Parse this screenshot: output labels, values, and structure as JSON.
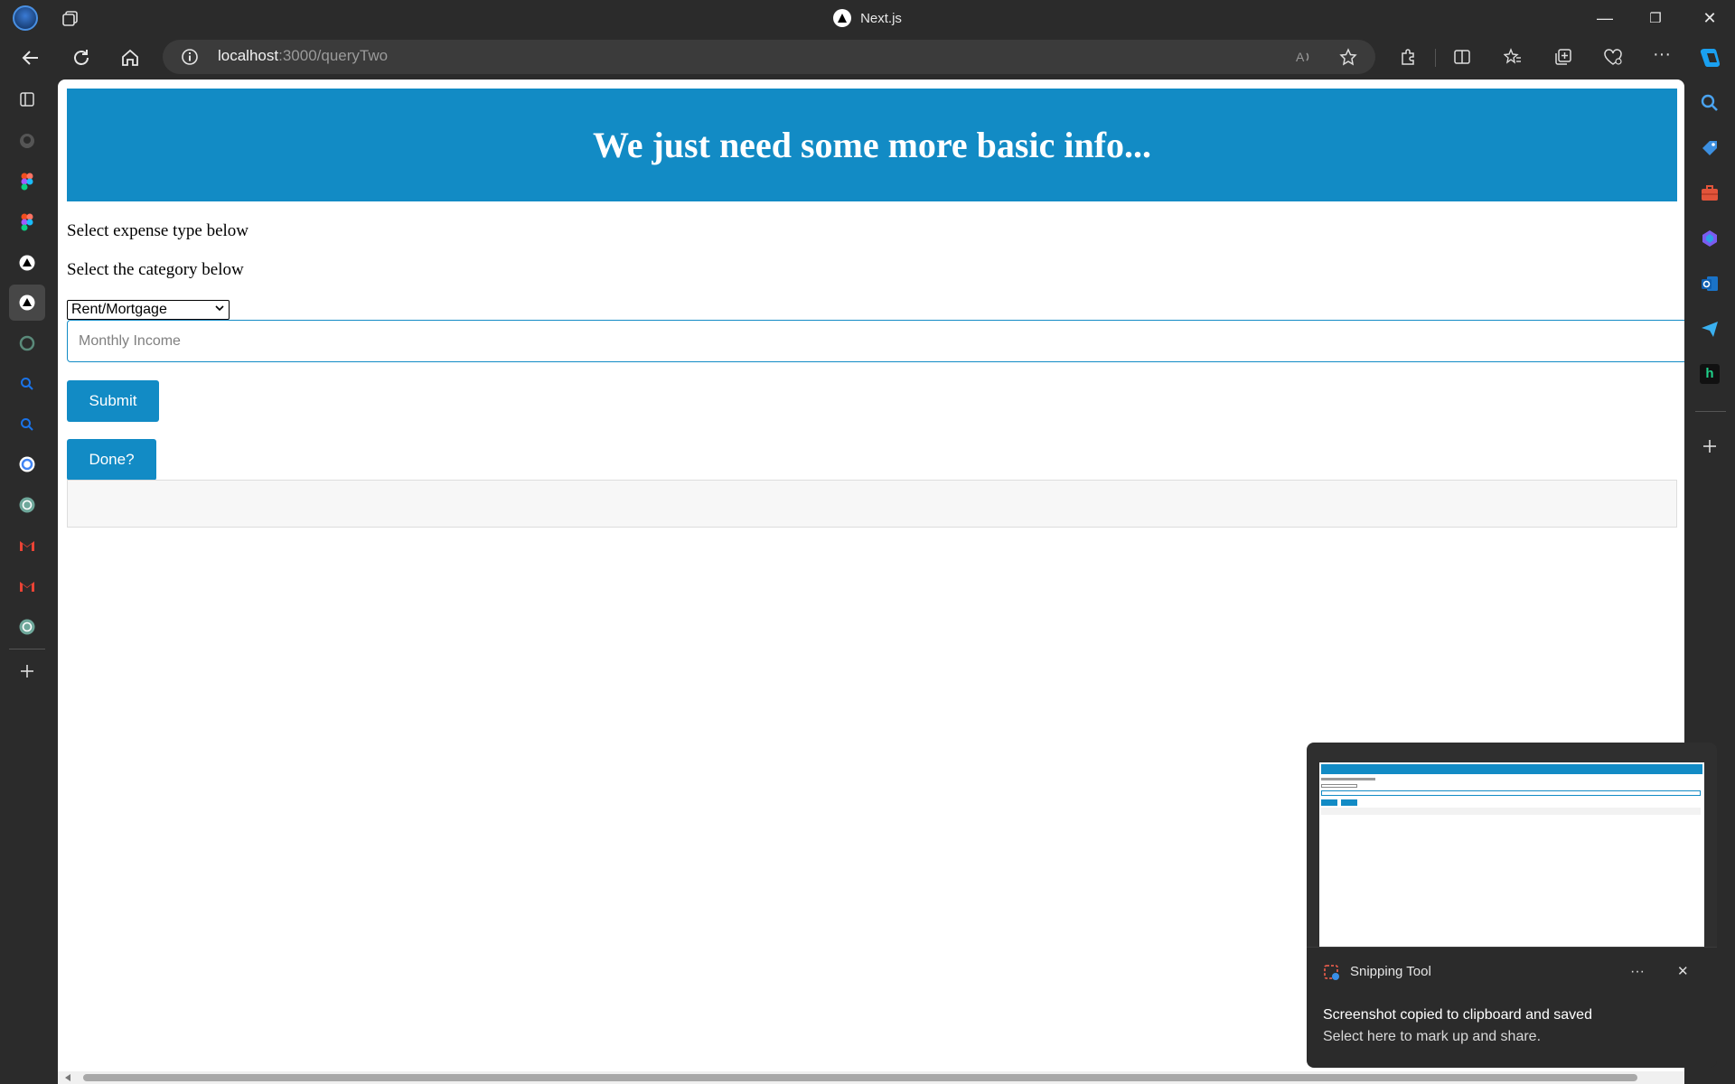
{
  "window": {
    "title": "Next.js",
    "minimize": "—",
    "maximize": "❐",
    "close": "✕"
  },
  "address": {
    "host": "localhost",
    "path": ":3000/queryTwo"
  },
  "page": {
    "heading": "We just need some more basic info...",
    "expense_label": "Select expense type below",
    "category_label": "Select the category below",
    "category_select": {
      "selected": "Rent/Mortgage"
    },
    "income_input": {
      "placeholder": "Monthly Income"
    },
    "submit_label": "Submit",
    "done_label": "Done?"
  },
  "toast": {
    "app_name": "Snipping Tool",
    "title": "Screenshot copied to clipboard and saved",
    "body": "Select here to mark up and share.",
    "more": "···",
    "close": "✕"
  },
  "colors": {
    "accent": "#128bc5",
    "chrome": "#2b2b2b"
  }
}
